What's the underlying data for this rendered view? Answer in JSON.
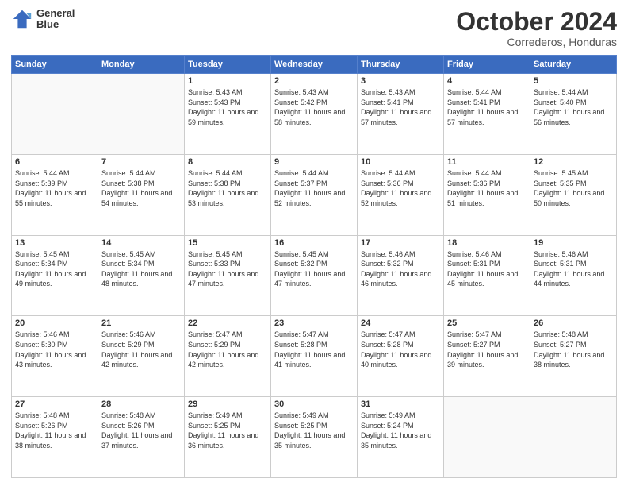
{
  "header": {
    "logo_line1": "General",
    "logo_line2": "Blue",
    "month": "October 2024",
    "location": "Correderos, Honduras"
  },
  "days_of_week": [
    "Sunday",
    "Monday",
    "Tuesday",
    "Wednesday",
    "Thursday",
    "Friday",
    "Saturday"
  ],
  "weeks": [
    [
      {
        "day": null,
        "info": null
      },
      {
        "day": null,
        "info": null
      },
      {
        "day": "1",
        "info": "Sunrise: 5:43 AM\nSunset: 5:43 PM\nDaylight: 11 hours and 59 minutes."
      },
      {
        "day": "2",
        "info": "Sunrise: 5:43 AM\nSunset: 5:42 PM\nDaylight: 11 hours and 58 minutes."
      },
      {
        "day": "3",
        "info": "Sunrise: 5:43 AM\nSunset: 5:41 PM\nDaylight: 11 hours and 57 minutes."
      },
      {
        "day": "4",
        "info": "Sunrise: 5:44 AM\nSunset: 5:41 PM\nDaylight: 11 hours and 57 minutes."
      },
      {
        "day": "5",
        "info": "Sunrise: 5:44 AM\nSunset: 5:40 PM\nDaylight: 11 hours and 56 minutes."
      }
    ],
    [
      {
        "day": "6",
        "info": "Sunrise: 5:44 AM\nSunset: 5:39 PM\nDaylight: 11 hours and 55 minutes."
      },
      {
        "day": "7",
        "info": "Sunrise: 5:44 AM\nSunset: 5:38 PM\nDaylight: 11 hours and 54 minutes."
      },
      {
        "day": "8",
        "info": "Sunrise: 5:44 AM\nSunset: 5:38 PM\nDaylight: 11 hours and 53 minutes."
      },
      {
        "day": "9",
        "info": "Sunrise: 5:44 AM\nSunset: 5:37 PM\nDaylight: 11 hours and 52 minutes."
      },
      {
        "day": "10",
        "info": "Sunrise: 5:44 AM\nSunset: 5:36 PM\nDaylight: 11 hours and 52 minutes."
      },
      {
        "day": "11",
        "info": "Sunrise: 5:44 AM\nSunset: 5:36 PM\nDaylight: 11 hours and 51 minutes."
      },
      {
        "day": "12",
        "info": "Sunrise: 5:45 AM\nSunset: 5:35 PM\nDaylight: 11 hours and 50 minutes."
      }
    ],
    [
      {
        "day": "13",
        "info": "Sunrise: 5:45 AM\nSunset: 5:34 PM\nDaylight: 11 hours and 49 minutes."
      },
      {
        "day": "14",
        "info": "Sunrise: 5:45 AM\nSunset: 5:34 PM\nDaylight: 11 hours and 48 minutes."
      },
      {
        "day": "15",
        "info": "Sunrise: 5:45 AM\nSunset: 5:33 PM\nDaylight: 11 hours and 47 minutes."
      },
      {
        "day": "16",
        "info": "Sunrise: 5:45 AM\nSunset: 5:32 PM\nDaylight: 11 hours and 47 minutes."
      },
      {
        "day": "17",
        "info": "Sunrise: 5:46 AM\nSunset: 5:32 PM\nDaylight: 11 hours and 46 minutes."
      },
      {
        "day": "18",
        "info": "Sunrise: 5:46 AM\nSunset: 5:31 PM\nDaylight: 11 hours and 45 minutes."
      },
      {
        "day": "19",
        "info": "Sunrise: 5:46 AM\nSunset: 5:31 PM\nDaylight: 11 hours and 44 minutes."
      }
    ],
    [
      {
        "day": "20",
        "info": "Sunrise: 5:46 AM\nSunset: 5:30 PM\nDaylight: 11 hours and 43 minutes."
      },
      {
        "day": "21",
        "info": "Sunrise: 5:46 AM\nSunset: 5:29 PM\nDaylight: 11 hours and 42 minutes."
      },
      {
        "day": "22",
        "info": "Sunrise: 5:47 AM\nSunset: 5:29 PM\nDaylight: 11 hours and 42 minutes."
      },
      {
        "day": "23",
        "info": "Sunrise: 5:47 AM\nSunset: 5:28 PM\nDaylight: 11 hours and 41 minutes."
      },
      {
        "day": "24",
        "info": "Sunrise: 5:47 AM\nSunset: 5:28 PM\nDaylight: 11 hours and 40 minutes."
      },
      {
        "day": "25",
        "info": "Sunrise: 5:47 AM\nSunset: 5:27 PM\nDaylight: 11 hours and 39 minutes."
      },
      {
        "day": "26",
        "info": "Sunrise: 5:48 AM\nSunset: 5:27 PM\nDaylight: 11 hours and 38 minutes."
      }
    ],
    [
      {
        "day": "27",
        "info": "Sunrise: 5:48 AM\nSunset: 5:26 PM\nDaylight: 11 hours and 38 minutes."
      },
      {
        "day": "28",
        "info": "Sunrise: 5:48 AM\nSunset: 5:26 PM\nDaylight: 11 hours and 37 minutes."
      },
      {
        "day": "29",
        "info": "Sunrise: 5:49 AM\nSunset: 5:25 PM\nDaylight: 11 hours and 36 minutes."
      },
      {
        "day": "30",
        "info": "Sunrise: 5:49 AM\nSunset: 5:25 PM\nDaylight: 11 hours and 35 minutes."
      },
      {
        "day": "31",
        "info": "Sunrise: 5:49 AM\nSunset: 5:24 PM\nDaylight: 11 hours and 35 minutes."
      },
      {
        "day": null,
        "info": null
      },
      {
        "day": null,
        "info": null
      }
    ]
  ]
}
